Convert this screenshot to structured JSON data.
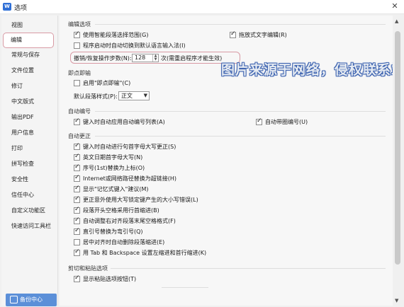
{
  "window": {
    "title": "选项",
    "app_icon": "W"
  },
  "sidebar": {
    "items": [
      {
        "label": "视图"
      },
      {
        "label": "编辑"
      },
      {
        "label": "常规与保存"
      },
      {
        "label": "文件位置"
      },
      {
        "label": "修订"
      },
      {
        "label": "中文版式"
      },
      {
        "label": "输出PDF"
      },
      {
        "label": "用户信息"
      },
      {
        "label": "打印"
      },
      {
        "label": "拼写检查"
      },
      {
        "label": "安全性"
      },
      {
        "label": "信任中心"
      },
      {
        "label": "自定义功能区"
      },
      {
        "label": "快速访问工具栏"
      }
    ],
    "active_index": 1,
    "backup_label": "备份中心"
  },
  "edit_options": {
    "section_title": "编辑选项",
    "smart_paragraph": {
      "label": "使用智能段落选择范围(G)",
      "checked": true
    },
    "drag_drop": {
      "label": "拖放式文字编辑(R)",
      "checked": true
    },
    "auto_switch_ime": {
      "label": "程序启动时自动切换到默认语言输入法(I)",
      "checked": false
    },
    "undo_steps_label": "撤销/恢复操作步数(N):",
    "undo_steps_value": "128",
    "undo_steps_note": "次(需重启程序才能生效)"
  },
  "ime": {
    "section_title": "即点即输",
    "enable": {
      "label": "启用\"即点即输\"(C)",
      "checked": false
    },
    "default_style_label": "默认段落样式(P):",
    "default_style_value": "正文"
  },
  "auto_numbering": {
    "section_title": "自动编号",
    "auto_list": {
      "label": "键入时自动应用自动编号列表(A)",
      "checked": true
    },
    "auto_bullet": {
      "label": "自动带圈编号(U)",
      "checked": true
    }
  },
  "auto_correct": {
    "section_title": "自动更正",
    "items": [
      {
        "label": "键入时自动进行句首字母大写更正(S)",
        "checked": true
      },
      {
        "label": "英文日期首字母大写(N)",
        "checked": true
      },
      {
        "label": "序号(1st)替换为上标(O)",
        "checked": true
      },
      {
        "label": "Internet或网络路径替换为超链接(H)",
        "checked": true
      },
      {
        "label": "显示\"记忆式键入\"建议(M)",
        "checked": true
      },
      {
        "label": "更正意外使用大写锁定键产生的大小写错误(L)",
        "checked": true
      },
      {
        "label": "段落开头空格采用行首缩进(B)",
        "checked": true
      },
      {
        "label": "自动调整右对齐段落末尾空格格式(F)",
        "checked": true
      },
      {
        "label": "直引号替换为弯引号(Q)",
        "checked": true
      },
      {
        "label": "居中对齐时自动删除段落缩进(E)",
        "checked": false
      },
      {
        "label": "用 Tab 和 Backspace 设置左缩进和首行缩进(K)",
        "checked": true
      }
    ]
  },
  "cut_paste": {
    "section_title": "剪切和粘贴选项",
    "show_paste_btn": {
      "label": "显示粘贴选项按钮(T)",
      "checked": true
    }
  },
  "watermark_text": "图片来源于网络，侵权联系站长删除！",
  "colors": {
    "accent": "#5b8fd8",
    "highlight_border": "#d89aa4",
    "watermark_stroke": "#3d63b0"
  }
}
